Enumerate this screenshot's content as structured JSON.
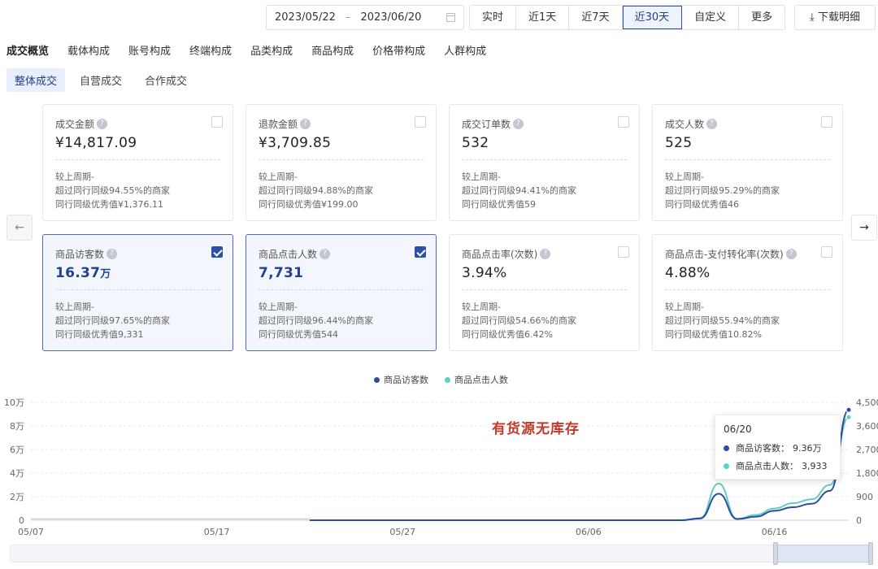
{
  "toolbar": {
    "date_start": "2023/05/22",
    "date_sep": "–",
    "date_end": "2023/06/20",
    "ranges": [
      "实时",
      "近1天",
      "近7天",
      "近30天",
      "自定义",
      "更多"
    ],
    "active_range": "近30天",
    "download_label": "下载明细"
  },
  "tabs": [
    "成交概览",
    "载体构成",
    "账号构成",
    "终端构成",
    "品类构成",
    "商品构成",
    "价格带构成",
    "人群构成"
  ],
  "active_tab": "成交概览",
  "subtabs": [
    "整体成交",
    "自营成交",
    "合作成交"
  ],
  "active_subtab": "整体成交",
  "cards": [
    {
      "title": "成交金额",
      "value": "¥14,817.09",
      "unit": "",
      "compare": "较上周期-",
      "line2": "超过同行同级94.55%的商家",
      "line3": "同行同级优秀值¥1,376.11",
      "selected": false
    },
    {
      "title": "退款金额",
      "value": "¥3,709.85",
      "unit": "",
      "compare": "较上周期-",
      "line2": "超过同行同级94.88%的商家",
      "line3": "同行同级优秀值¥199.00",
      "selected": false
    },
    {
      "title": "成交订单数",
      "value": "532",
      "unit": "",
      "compare": "较上周期-",
      "line2": "超过同行同级94.41%的商家",
      "line3": "同行同级优秀值59",
      "selected": false
    },
    {
      "title": "成交人数",
      "value": "525",
      "unit": "",
      "compare": "较上周期-",
      "line2": "超过同行同级95.29%的商家",
      "line3": "同行同级优秀值46",
      "selected": false
    },
    {
      "title": "商品访客数",
      "value": "16.37",
      "unit": "万",
      "compare": "较上周期-",
      "line2": "超过同行同级97.65%的商家",
      "line3": "同行同级优秀值9,331",
      "selected": true
    },
    {
      "title": "商品点击人数",
      "value": "7,731",
      "unit": "",
      "compare": "较上周期-",
      "line2": "超过同行同级96.44%的商家",
      "line3": "同行同级优秀值544",
      "selected": true
    },
    {
      "title": "商品点击率(次数)",
      "value": "3.94%",
      "unit": "",
      "compare": "较上周期-",
      "line2": "超过同行同级54.66%的商家",
      "line3": "同行同级优秀值6.42%",
      "selected": false
    },
    {
      "title": "商品点击-支付转化率(次数)",
      "value": "4.88%",
      "unit": "",
      "compare": "较上周期-",
      "line2": "超过同行同级55.94%的商家",
      "line3": "同行同级优秀值10.82%",
      "selected": false
    }
  ],
  "colors": {
    "accent": "#2b4a9b",
    "visitors": "#2e4da0",
    "clickers": "#5ecfc0",
    "annotation": "#c0392b"
  },
  "annotation": "有货源无库存",
  "tooltip": {
    "date": "06/20",
    "rows": [
      {
        "label": "商品访客数：",
        "value": "9.36万"
      },
      {
        "label": "商品点击人数：",
        "value": "3,933"
      }
    ]
  },
  "chart_data": {
    "type": "line",
    "legend": [
      "商品访客数",
      "商品点击人数"
    ],
    "x_ticks": [
      "05/07",
      "05/17",
      "05/27",
      "06/06",
      "06/16"
    ],
    "y_left_ticks": [
      "10万",
      "8万",
      "6万",
      "4万",
      "2万",
      "0"
    ],
    "y_right_ticks": [
      "4,500",
      "3,600",
      "2,700",
      "1,800",
      "900",
      "0"
    ],
    "y_left_range": [
      0,
      100000
    ],
    "y_right_range": [
      0,
      4500
    ],
    "x_range": [
      "05/07",
      "06/20"
    ],
    "series": [
      {
        "name": "商品访客数",
        "axis": "left",
        "x": [
          "05/22",
          "05/24",
          "05/26",
          "05/28",
          "05/30",
          "06/01",
          "06/03",
          "06/05",
          "06/07",
          "06/09",
          "06/10",
          "06/11",
          "06/12",
          "06/13",
          "06/14",
          "06/15",
          "06/16",
          "06/17",
          "06/18",
          "06/19",
          "06/20"
        ],
        "y": [
          0,
          0,
          0,
          0,
          0,
          0,
          0,
          0,
          0,
          0,
          0,
          0,
          1500,
          22500,
          1000,
          3000,
          8000,
          11000,
          14000,
          25000,
          93600
        ]
      },
      {
        "name": "商品点击人数",
        "axis": "right",
        "x": [
          "05/22",
          "05/24",
          "05/26",
          "05/28",
          "05/30",
          "06/01",
          "06/03",
          "06/05",
          "06/07",
          "06/09",
          "06/10",
          "06/11",
          "06/12",
          "06/13",
          "06/14",
          "06/15",
          "06/16",
          "06/17",
          "06/18",
          "06/19",
          "06/20"
        ],
        "y": [
          0,
          0,
          0,
          0,
          0,
          0,
          0,
          0,
          0,
          0,
          0,
          0,
          80,
          1400,
          50,
          200,
          450,
          650,
          800,
          1350,
          3933
        ]
      }
    ],
    "grid": true
  }
}
